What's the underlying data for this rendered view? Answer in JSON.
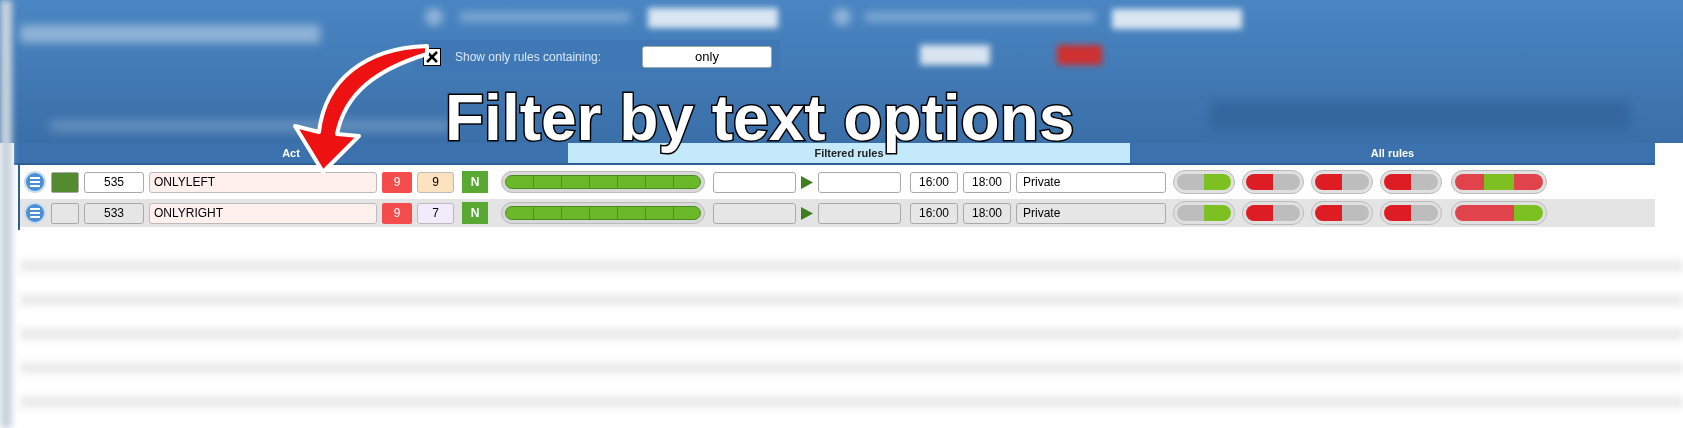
{
  "filter": {
    "checked": true,
    "label": "Show only rules containing:",
    "value": "only"
  },
  "caption": "Filter by text options",
  "tabs": [
    {
      "label": "Act",
      "selected": false
    },
    {
      "label": "Filtered rules",
      "selected": true
    },
    {
      "label": "All rules",
      "selected": false
    }
  ],
  "rows": [
    {
      "shaded": false,
      "swatch_filled": true,
      "id": "535",
      "name": "ONLYLEFT",
      "count_a": "9",
      "count_b": {
        "text": "9",
        "color": "#fde2c0"
      },
      "flag": "N",
      "level": 1,
      "start": "16:00",
      "end": "18:00",
      "visibility": "Private",
      "toggles": [
        {
          "on": true
        },
        {
          "on": false
        },
        {
          "on": false
        },
        {
          "on": false
        }
      ],
      "switch_segments": [
        {
          "on": false
        },
        {
          "on": true
        },
        {
          "on": false
        }
      ]
    },
    {
      "shaded": true,
      "swatch_filled": false,
      "id": "533",
      "name": "ONLYRIGHT",
      "count_a": "9",
      "count_b": {
        "text": "7",
        "color": "#f1ebfb"
      },
      "flag": "N",
      "level": 1,
      "start": "16:00",
      "end": "18:00",
      "visibility": "Private",
      "toggles": [
        {
          "on": true
        },
        {
          "on": false
        },
        {
          "on": false
        },
        {
          "on": false
        }
      ],
      "switch_segments": [
        {
          "on": false
        },
        {
          "on": false
        },
        {
          "on": true
        }
      ]
    }
  ]
}
